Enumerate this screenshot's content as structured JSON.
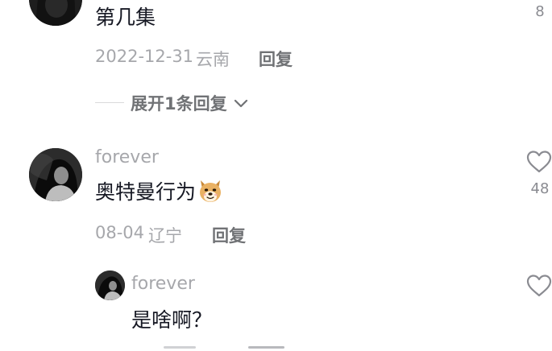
{
  "comments": [
    {
      "text": "第几集",
      "date": "2022-12-31",
      "location": "云南",
      "reply_label": "回复",
      "like_count": "8",
      "expand_label": "展开1条回复"
    },
    {
      "username": "forever",
      "text": "奥特曼行为",
      "emoji": "doge-emoji",
      "date": "08-04",
      "location": "辽宁",
      "reply_label": "回复",
      "like_count": "48",
      "replies": [
        {
          "username": "forever",
          "text": "是啥啊？"
        }
      ]
    }
  ],
  "icons": {
    "like": "heart-outline-icon",
    "expand": "chevron-down-icon"
  }
}
